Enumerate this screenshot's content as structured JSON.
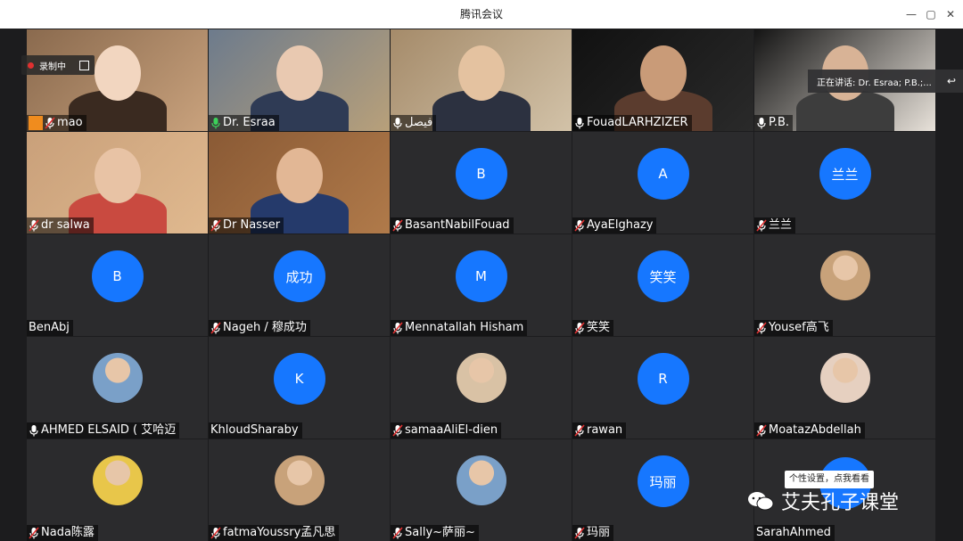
{
  "window": {
    "title": "腾讯会议",
    "controls": {
      "minimize": "—",
      "restore": "▢",
      "close": "✕"
    }
  },
  "recording": {
    "label": "录制中"
  },
  "speaking": {
    "label": "正在讲话: Dr. Esraa; P.B.;...",
    "icon": "undo-arrow-icon"
  },
  "tooltip": {
    "label": "个性设置，点我看看"
  },
  "watermark": {
    "label": "艾夫孔子课堂"
  },
  "participants": [
    {
      "name": "mao",
      "kind": "video",
      "host": true,
      "mic": "muted"
    },
    {
      "name": "Dr. Esraa",
      "kind": "video",
      "active": true,
      "mic": "speaking"
    },
    {
      "name": "فيصل",
      "kind": "video",
      "mic": "on"
    },
    {
      "name": "FouadLARHZIZER",
      "kind": "video",
      "mic": "on"
    },
    {
      "name": "P.B.",
      "kind": "video",
      "mic": "on"
    },
    {
      "name": "dr salwa",
      "kind": "video",
      "mic": "muted"
    },
    {
      "name": "Dr Nasser",
      "kind": "video",
      "mic": "muted"
    },
    {
      "name": "BasantNabilFouad",
      "kind": "avatar",
      "initial": "B",
      "mic": "muted"
    },
    {
      "name": "AyaElghazy",
      "kind": "avatar",
      "initial": "A",
      "mic": "muted"
    },
    {
      "name": "兰兰",
      "kind": "avatar",
      "initial": "兰兰",
      "mic": "muted"
    },
    {
      "name": "BenAbj",
      "kind": "avatar",
      "initial": "B",
      "mic": "none"
    },
    {
      "name": "Nageh / 穆成功",
      "kind": "avatar",
      "initial": "成功",
      "mic": "muted"
    },
    {
      "name": "Mennatallah Hisham",
      "kind": "avatar",
      "initial": "M",
      "mic": "muted"
    },
    {
      "name": "笑笑",
      "kind": "avatar",
      "initial": "笑笑",
      "mic": "muted"
    },
    {
      "name": "Yousef高飞",
      "kind": "photo",
      "mic": "muted"
    },
    {
      "name": "AHMED ELSAID ( 艾哈迈",
      "kind": "photo",
      "mic": "on"
    },
    {
      "name": "KhloudSharaby",
      "kind": "avatar",
      "initial": "K",
      "mic": "none"
    },
    {
      "name": "samaaAliEl-dien",
      "kind": "photo",
      "mic": "muted"
    },
    {
      "name": "rawan",
      "kind": "avatar",
      "initial": "R",
      "mic": "muted"
    },
    {
      "name": "MoatazAbdellah",
      "kind": "photo",
      "mic": "muted"
    },
    {
      "name": "Nada陈露",
      "kind": "photo",
      "mic": "muted"
    },
    {
      "name": "fatmaYoussry孟凡思",
      "kind": "photo",
      "mic": "muted"
    },
    {
      "name": "Sally~萨丽~",
      "kind": "photo",
      "mic": "muted"
    },
    {
      "name": "玛丽",
      "kind": "avatar",
      "initial": "玛丽",
      "mic": "muted"
    },
    {
      "name": "SarahAhmed",
      "kind": "avatar",
      "initial": "",
      "mic": "none"
    }
  ]
}
